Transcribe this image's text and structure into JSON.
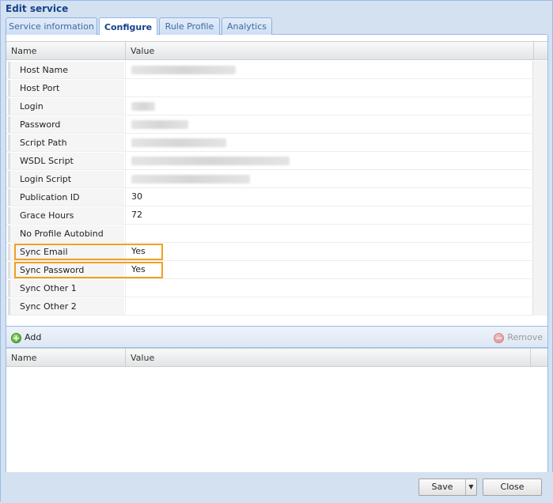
{
  "window": {
    "title": "Edit service"
  },
  "tabs": [
    {
      "label": "Service information",
      "active": false
    },
    {
      "label": "Configure",
      "active": true
    },
    {
      "label": "Rule Profile",
      "active": false
    },
    {
      "label": "Analytics",
      "active": false
    }
  ],
  "properties_grid": {
    "columns": {
      "name": "Name",
      "value": "Value"
    },
    "rows": [
      {
        "name": "Host Name",
        "value": ""
      },
      {
        "name": "Host Port",
        "value": ""
      },
      {
        "name": "Login",
        "value": ""
      },
      {
        "name": "Password",
        "value": ""
      },
      {
        "name": "Script Path",
        "value": ""
      },
      {
        "name": "WSDL Script",
        "value": ""
      },
      {
        "name": "Login Script",
        "value": ""
      },
      {
        "name": "Publication ID",
        "value": "30"
      },
      {
        "name": "Grace Hours",
        "value": "72"
      },
      {
        "name": "No Profile Autobind",
        "value": ""
      },
      {
        "name": "Sync Email",
        "value": "Yes"
      },
      {
        "name": "Sync Password",
        "value": "Yes"
      },
      {
        "name": "Sync Other 1",
        "value": ""
      },
      {
        "name": "Sync Other 2",
        "value": ""
      }
    ]
  },
  "toolbar": {
    "add_label": "Add",
    "remove_label": "Remove"
  },
  "custom_grid": {
    "columns": {
      "name": "Name",
      "value": "Value"
    }
  },
  "footer": {
    "save_label": "Save",
    "close_label": "Close"
  },
  "colors": {
    "highlight": "#f0a020",
    "accent": "#15428b"
  }
}
